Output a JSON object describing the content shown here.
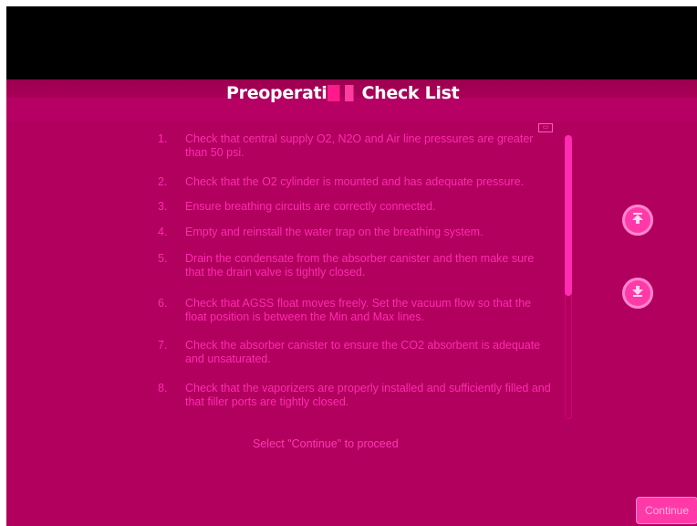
{
  "window": {
    "title_part1": "Preoperati",
    "title_part2": "Check List"
  },
  "checklist": {
    "items": [
      {
        "num": "1.",
        "text": "Check that central supply O2, N2O and Air line pressures are greater than 50 psi."
      },
      {
        "num": "2.",
        "text": "Check that the O2 cylinder is mounted and has adequate pressure."
      },
      {
        "num": "3.",
        "text": "Ensure breathing circuits are correctly connected."
      },
      {
        "num": "4.",
        "text": "Empty and reinstall the water trap on the breathing system."
      },
      {
        "num": "5.",
        "text": "Drain the condensate from the absorber canister and then make sure that the drain valve is tightly closed."
      },
      {
        "num": "6.",
        "text": "Check that AGSS float moves freely. Set the vacuum flow so that the float position is between the Min and Max lines."
      },
      {
        "num": "7.",
        "text": "Check the absorber canister to ensure the CO2 absorbent is adequate and unsaturated."
      },
      {
        "num": "8.",
        "text": "Check that the vaporizers are properly installed and sufficiently filled and that filler ports are tightly closed."
      }
    ]
  },
  "scroll": {
    "up_icon": "arrow-up-icon",
    "down_icon": "arrow-down-icon",
    "position_fraction": 0.0,
    "visible_fraction": 0.57
  },
  "footer": {
    "hint": "Select \"Continue\" to proceed",
    "continue_label": "Continue"
  },
  "colors": {
    "background": "#b1005e",
    "header": "#000000",
    "text": "#ff2bb0",
    "accent": "#ff3aa8"
  }
}
